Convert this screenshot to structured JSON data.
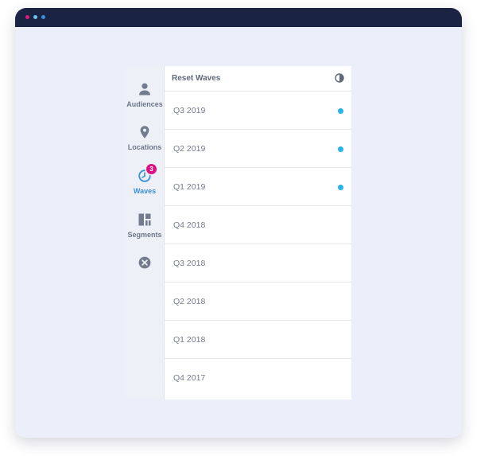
{
  "window": {
    "dots": [
      "#e0197d",
      "#6cc3ef",
      "#3a8fd6"
    ]
  },
  "sidebar": {
    "items": [
      {
        "label": "Audiences",
        "icon": "person-icon"
      },
      {
        "label": "Locations",
        "icon": "location-pin-icon"
      },
      {
        "label": "Waves",
        "icon": "clock-icon",
        "badge": "3",
        "active": true
      },
      {
        "label": "Segments",
        "icon": "segments-icon"
      },
      {
        "label": "",
        "icon": "close-circle-icon"
      }
    ]
  },
  "header": {
    "reset_label": "Reset Waves",
    "contrast_icon": "contrast-icon"
  },
  "waves": [
    {
      "label": "Q3 2019",
      "selected": true
    },
    {
      "label": "Q2 2019",
      "selected": true
    },
    {
      "label": "Q1 2019",
      "selected": true
    },
    {
      "label": "Q4 2018",
      "selected": false
    },
    {
      "label": "Q3 2018",
      "selected": false
    },
    {
      "label": "Q2 2018",
      "selected": false
    },
    {
      "label": "Q1 2018",
      "selected": false
    },
    {
      "label": "Q4 2017",
      "selected": false
    }
  ],
  "colors": {
    "accent": "#3b8fd4",
    "badge": "#d9137f",
    "selected_dot": "#25b3ea",
    "titlebar": "#1a2341"
  }
}
